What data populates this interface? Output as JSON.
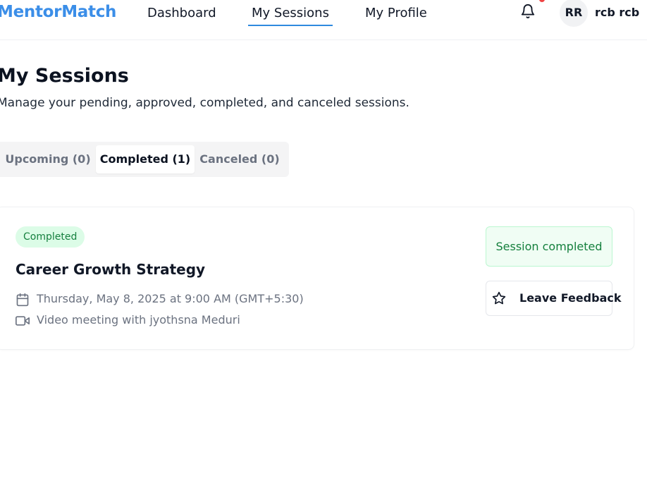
{
  "app": {
    "brand": "MentorMatch",
    "accent_color": "#3b8ee8"
  },
  "nav": {
    "links": [
      {
        "label": "Dashboard",
        "active": false
      },
      {
        "label": "My Sessions",
        "active": true
      },
      {
        "label": "My Profile",
        "active": false
      }
    ],
    "notification_icon": "bell-icon",
    "user": {
      "initials": "RR",
      "name": "rcb rcb"
    }
  },
  "header": {
    "title": "My Sessions",
    "subtitle": "Manage your pending, approved, completed, and canceled sessions."
  },
  "tabs": [
    {
      "label": "Upcoming (0)",
      "active": false
    },
    {
      "label": "Completed (1)",
      "active": true
    },
    {
      "label": "Canceled (0)",
      "active": false
    }
  ],
  "sessions": [
    {
      "status_badge": "Completed",
      "status_color": "#16803f",
      "title": "Career Growth Strategy",
      "datetime": "Thursday, May 8, 2025 at 9:00 AM (GMT+5:30)",
      "datetime_icon": "calendar-icon",
      "meeting": "Video meeting with jyothsna Meduri",
      "meeting_icon": "video-icon",
      "status_message": "Session completed",
      "feedback_label": "Leave Feedback",
      "feedback_icon": "star-icon"
    }
  ]
}
